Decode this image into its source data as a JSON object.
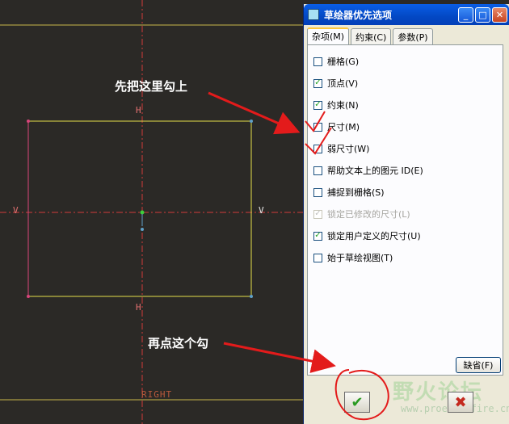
{
  "canvas": {
    "dim_labels": {
      "h_top": "H",
      "h_bottom": "H",
      "v_left": "V",
      "v_right": "V"
    },
    "right_label": "RIGHT",
    "annotations": {
      "first": "先把这里勾上",
      "second": "再点这个勾"
    },
    "colors": {
      "background": "#2b2926",
      "rectangle": "#e6e04a",
      "centerline": "#d03a3a",
      "arrow": "#e31b1b"
    }
  },
  "dialog": {
    "title": "草绘器优先选项",
    "window_buttons": {
      "minimize": "_",
      "maximize": "□",
      "close": "✕"
    },
    "tabs": [
      {
        "label": "杂项(M)",
        "active": true
      },
      {
        "label": "约束(C)",
        "active": false
      },
      {
        "label": "参数(P)",
        "active": false
      }
    ],
    "options": [
      {
        "label": "栅格(G)",
        "checked": false,
        "mark": ""
      },
      {
        "label": "顶点(V)",
        "checked": true,
        "mark": "✓"
      },
      {
        "label": "约束(N)",
        "checked": true,
        "mark": "✓"
      },
      {
        "label": "尺寸(M)",
        "checked": false,
        "mark": ""
      },
      {
        "label": "弱尺寸(W)",
        "checked": false,
        "mark": ""
      },
      {
        "label": "帮助文本上的图元 ID(E)",
        "checked": false,
        "mark": ""
      },
      {
        "label": "捕捉到栅格(S)",
        "checked": false,
        "mark": ""
      },
      {
        "label": "锁定已修改的尺寸(L)",
        "checked": true,
        "disabled": true,
        "mark": "✓"
      },
      {
        "label": "锁定用户定义的尺寸(U)",
        "checked": true,
        "mark": "✓"
      },
      {
        "label": "始于草绘视图(T)",
        "checked": false,
        "mark": ""
      }
    ],
    "default_button": "缺省(F)",
    "ok_icon": "✔",
    "cancel_icon": "✖",
    "watermark": "野火论坛",
    "watermark_url": "www.proewildfire.cn"
  }
}
